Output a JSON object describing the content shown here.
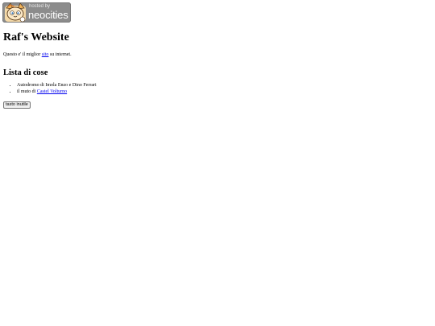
{
  "badge": {
    "line1": "hosted by",
    "line2": "neocities",
    "mascot_icon": "neocities-cat-icon"
  },
  "header": {
    "title": "Raf's Website"
  },
  "intro": {
    "before": "Questo e' il miglior ",
    "link_text": "sito",
    "after": " su internet."
  },
  "list": {
    "heading": "Lista di cose",
    "items": [
      {
        "text": "Autodromo di Imola Enzo e Dino Ferrari"
      },
      {
        "text_before": "il muto di ",
        "link_text": "Castel Volturno"
      }
    ]
  },
  "useless_button": {
    "label": "tasto inutile"
  },
  "colors": {
    "link": "#0000ee",
    "badge_bg": "#8c8c8c"
  }
}
